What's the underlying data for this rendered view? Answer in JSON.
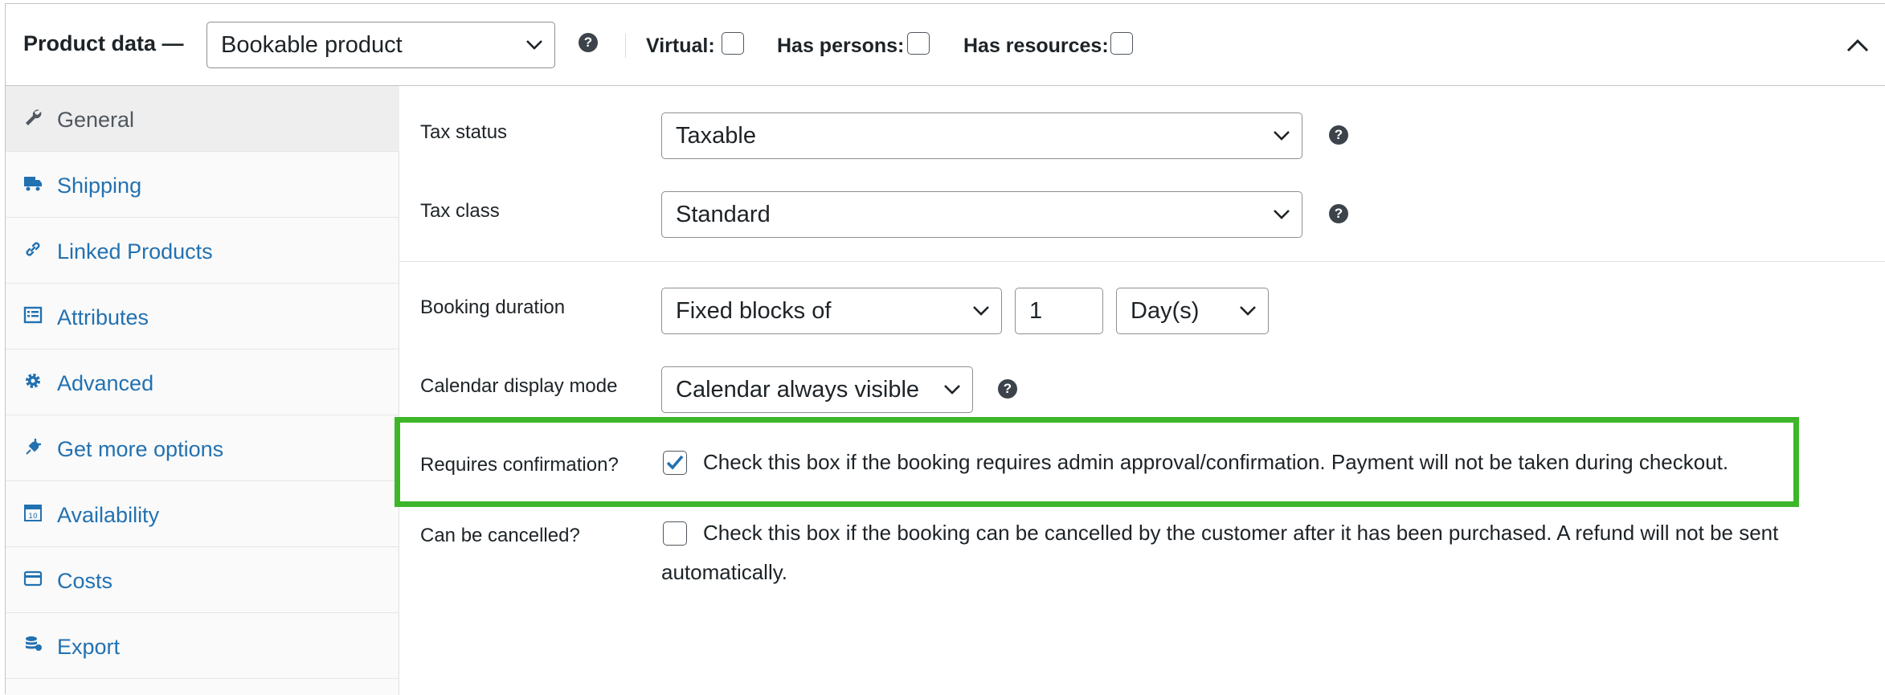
{
  "header": {
    "title": "Product data —",
    "product_type": "Bookable product",
    "virtual_label": "Virtual:",
    "has_persons_label": "Has persons:",
    "has_resources_label": "Has resources:",
    "help_glyph": "?"
  },
  "sidebar": {
    "items": [
      {
        "label": "General",
        "icon": "wrench-icon"
      },
      {
        "label": "Shipping",
        "icon": "truck-icon"
      },
      {
        "label": "Linked Products",
        "icon": "link-icon"
      },
      {
        "label": "Attributes",
        "icon": "list-icon"
      },
      {
        "label": "Advanced",
        "icon": "gear-icon"
      },
      {
        "label": "Get more options",
        "icon": "plug-icon"
      },
      {
        "label": "Availability",
        "icon": "calendar-icon"
      },
      {
        "label": "Costs",
        "icon": "card-icon"
      },
      {
        "label": "Export",
        "icon": "database-icon"
      }
    ]
  },
  "general": {
    "tax_status_label": "Tax status",
    "tax_status_value": "Taxable",
    "tax_class_label": "Tax class",
    "tax_class_value": "Standard",
    "booking_duration_label": "Booking duration",
    "booking_duration_type": "Fixed blocks of",
    "booking_duration_value": "1",
    "booking_duration_unit": "Day(s)",
    "calendar_display_label": "Calendar display mode",
    "calendar_display_value": "Calendar always visible",
    "requires_confirmation_label": "Requires confirmation?",
    "requires_confirmation_desc": "Check this box if the booking requires admin approval/confirmation. Payment will not be taken during checkout.",
    "requires_confirmation_checked": true,
    "can_be_cancelled_label": "Can be cancelled?",
    "can_be_cancelled_desc_line1": "Check this box if the booking can be cancelled by the customer after it has been purchased. A refund will not be sent",
    "can_be_cancelled_desc_line2": "automatically.",
    "can_be_cancelled_checked": false
  },
  "colors": {
    "link": "#2271b1",
    "highlight": "#3db62a",
    "checkmark": "#2271b1"
  }
}
